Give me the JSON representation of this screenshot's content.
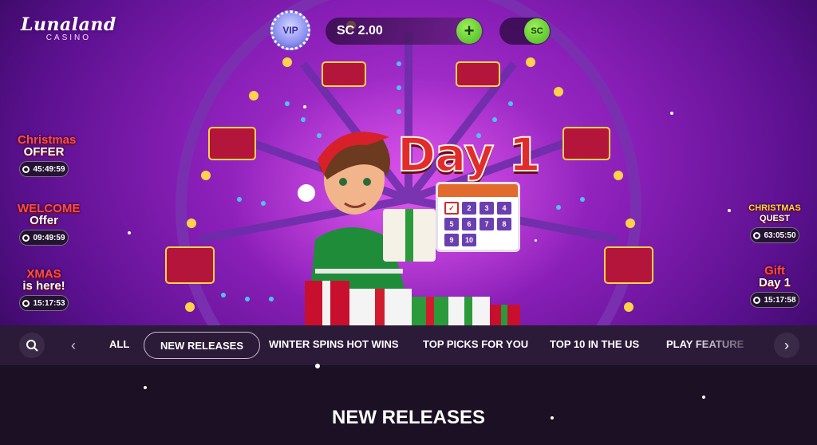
{
  "header": {
    "logo_main": "Lunaland",
    "logo_sub": "CASINO",
    "vip_label": "VIP",
    "balance": "SC 2.00",
    "add_label": "+",
    "currency_toggle": "SC"
  },
  "promos_left": [
    {
      "line1": "Christmas",
      "line2": "OFFER",
      "timer": "45:49:59"
    },
    {
      "line1": "WELCOME",
      "line2": "Offer",
      "timer": "09:49:59"
    },
    {
      "line1": "XMAS",
      "line2": "is here!",
      "timer": "15:17:53"
    }
  ],
  "promos_right": [
    {
      "line1": "CHRISTMAS",
      "line2": "QUEST",
      "timer": "63:05:50"
    },
    {
      "line1": "Gift",
      "line2": "Day 1",
      "timer": "15:17:58"
    }
  ],
  "hero": {
    "title": "Day 1",
    "calendar_days": [
      "✓",
      "2",
      "3",
      "4",
      "5",
      "6",
      "7",
      "8",
      "9",
      "10"
    ]
  },
  "categories": {
    "items": [
      "ALL",
      "NEW RELEASES",
      "WINTER SPINS HOT WINS",
      "TOP PICKS FOR YOU",
      "TOP 10 IN THE US",
      "PLAY FEATURE"
    ],
    "active": "NEW RELEASES"
  },
  "section": {
    "title": "NEW RELEASES"
  },
  "colors": {
    "accent_green": "#45b51f",
    "hero_purple": "#8a1fb8",
    "bar_bg": "#2b1a38"
  },
  "icons": [
    "search-icon",
    "chevron-left-icon",
    "chevron-right-icon",
    "clock-icon"
  ]
}
